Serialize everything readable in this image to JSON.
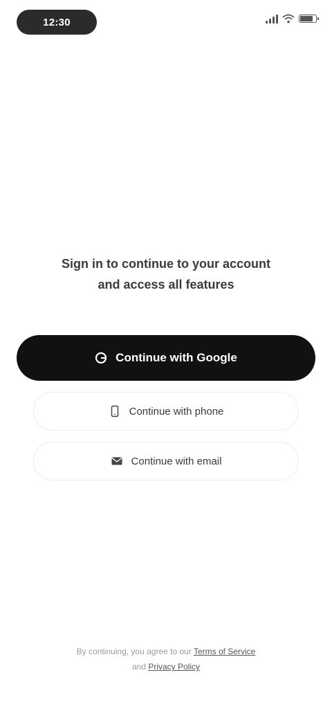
{
  "status_bar": {
    "time": "12:30",
    "battery_percent": "85%",
    "battery_level": 0.85,
    "sub_line_1": "",
    "sub_line_2": ""
  },
  "prompt": {
    "line1": "Sign in to continue to your account",
    "line2": "and access all features"
  },
  "buttons": {
    "primary_label": "Continue with Google",
    "phone_label": "Continue with phone",
    "email_label": "Continue with email"
  },
  "footer": {
    "text_prefix": "By continuing, you agree to our ",
    "terms_link": "Terms of Service",
    "text_middle": " and ",
    "privacy_link": "Privacy Policy"
  },
  "icons": {
    "primary": "google-icon",
    "phone": "phone-icon",
    "email": "mail-icon"
  },
  "colors": {
    "primary_button": "#111111",
    "background": "#ffffff"
  }
}
